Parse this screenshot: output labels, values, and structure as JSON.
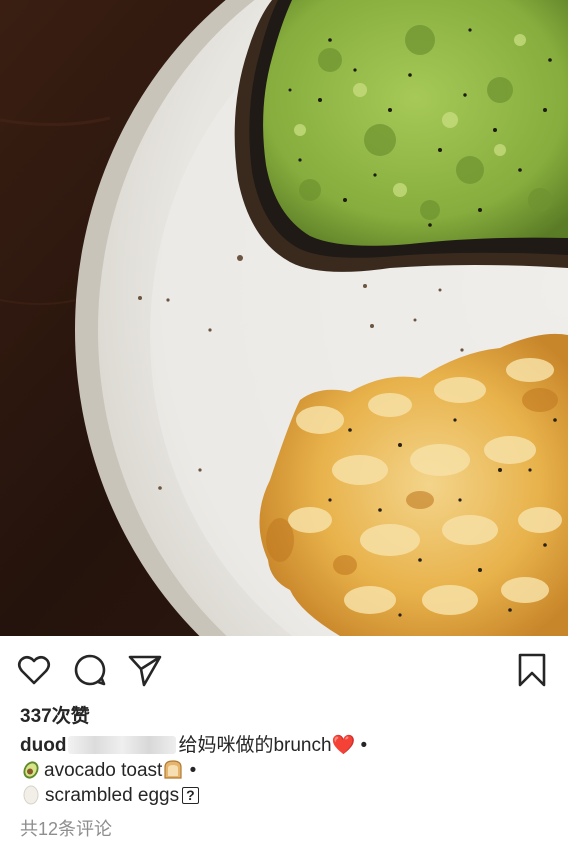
{
  "post": {
    "photo_alt_icon": "food-photo",
    "likes_text": "337次赞",
    "caption": {
      "username_visible": "duod",
      "title_text": "给妈咪做的brunch",
      "heart_emoji": "❤️",
      "separator_1": "•",
      "line2_text": "avocado toast",
      "separator_2": "•",
      "line3_text": "scrambled eggs",
      "unknown_glyph": "?"
    },
    "comments_text": "共12条评论"
  },
  "actions": {
    "like_icon": "heart-icon",
    "comment_icon": "comment-icon",
    "share_icon": "send-icon",
    "save_icon": "bookmark-icon"
  },
  "colors": {
    "text": "#262626",
    "muted": "#8e8e8e",
    "heart": "#e0253b",
    "plate": "#ecebe7",
    "table": "#2b1710",
    "avocado": "#8fb843",
    "egg": "#e9b24a"
  }
}
